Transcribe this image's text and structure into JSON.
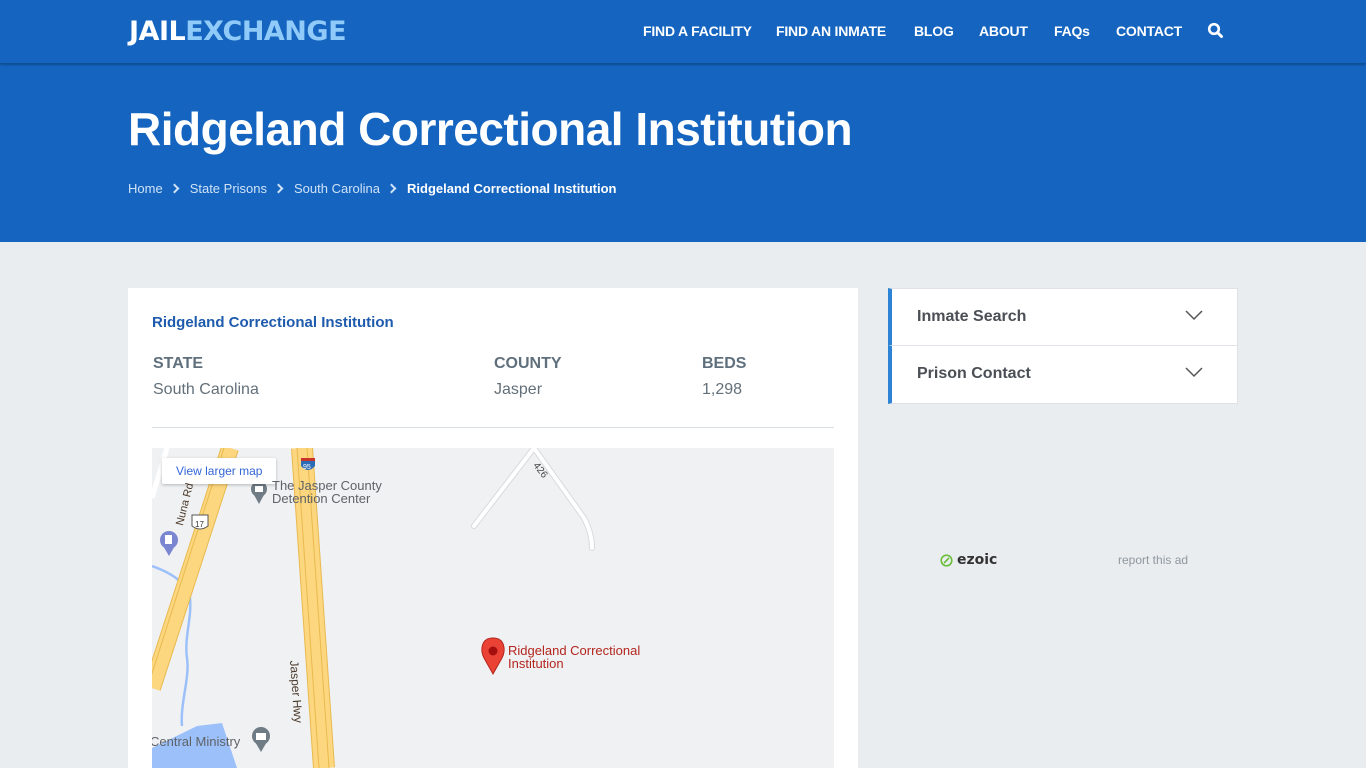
{
  "logo": {
    "part1": "JAIL",
    "part2": "EXCHANGE"
  },
  "nav": {
    "items": [
      {
        "label": "FIND A FACILITY"
      },
      {
        "label": "FIND AN INMATE"
      },
      {
        "label": "BLOG"
      },
      {
        "label": "ABOUT"
      },
      {
        "label": "FAQs"
      },
      {
        "label": "CONTACT"
      }
    ],
    "search_icon": "search-icon"
  },
  "hero": {
    "title": "Ridgeland Correctional Institution",
    "breadcrumb": [
      {
        "label": "Home"
      },
      {
        "label": "State Prisons"
      },
      {
        "label": "South Carolina"
      },
      {
        "label": "Ridgeland Correctional Institution"
      }
    ]
  },
  "facility": {
    "title": "Ridgeland Correctional Institution",
    "fields": [
      {
        "label": "STATE",
        "value": "South Carolina"
      },
      {
        "label": "COUNTY",
        "value": "Jasper"
      },
      {
        "label": "BEDS",
        "value": "1,298"
      }
    ]
  },
  "map": {
    "view_larger": "View larger map",
    "labels": {
      "detention_line1": "The Jasper County",
      "detention_line2": "Detention Center",
      "marker_line1": "Ridgeland Correctional",
      "marker_line2": "Institution",
      "jasper_hwy": "Jasper Hwy",
      "nuna_rd": "Nuna Rd",
      "route_426": "426",
      "central_ministry": "Central Ministry",
      "shield_17": "17",
      "shield_95": "95"
    },
    "colors": {
      "highway": "#fdd77f",
      "water": "#9cc0f9",
      "marker": "#ea4335",
      "background": "#f0f1f3"
    }
  },
  "sidebar": {
    "items": [
      {
        "label": "Inmate Search"
      },
      {
        "label": "Prison Contact"
      }
    ]
  },
  "ad": {
    "brand": "ezoic",
    "report": "report this ad"
  },
  "colors": {
    "brand_blue": "#1565c0",
    "accent_light": "#90caf9",
    "page_bg": "#e9edf0"
  }
}
